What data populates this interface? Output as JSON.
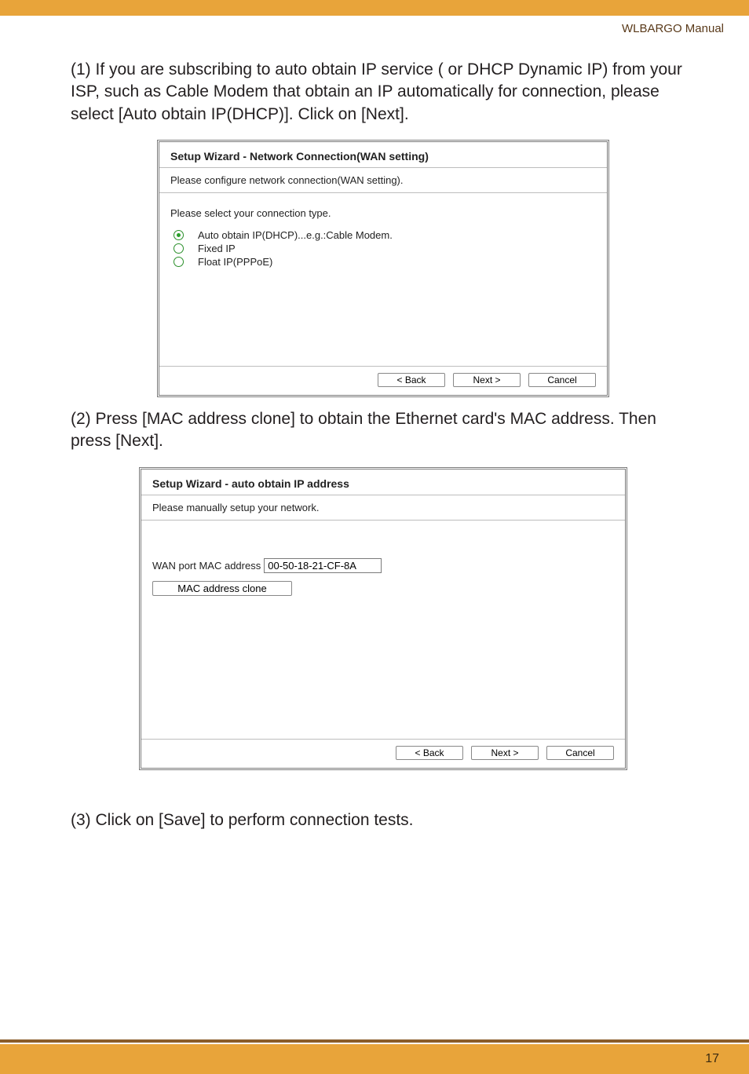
{
  "header": {
    "manual_name": "WLBARGO Manual"
  },
  "paragraphs": {
    "p1": "(1) If you are subscribing to auto obtain IP service ( or DHCP Dynamic IP) from your ISP, such as Cable Modem that obtain an IP automatically for connection, please select [Auto obtain IP(DHCP)]. Click on [Next].",
    "p2": "(2) Press [MAC address clone] to obtain the Ethernet card's MAC address. Then press [Next].",
    "p3": "(3) Click on [Save] to perform connection tests."
  },
  "wizard1": {
    "title": "Setup Wizard - Network Connection(WAN setting)",
    "subtitle": "Please configure network connection(WAN setting).",
    "prompt": "Please select your connection type.",
    "options": [
      {
        "label": "Auto obtain IP(DHCP)...e.g.:Cable Modem.",
        "selected": true
      },
      {
        "label": "Fixed IP",
        "selected": false
      },
      {
        "label": "Float IP(PPPoE)",
        "selected": false
      }
    ],
    "buttons": {
      "back": "< Back",
      "next": "Next >",
      "cancel": "Cancel"
    }
  },
  "wizard2": {
    "title": "Setup Wizard - auto obtain IP address",
    "subtitle": "Please manually setup your network.",
    "mac_label": "WAN port MAC address",
    "mac_value": "00-50-18-21-CF-8A",
    "clone_button": "MAC address clone",
    "buttons": {
      "back": "< Back",
      "next": "Next >",
      "cancel": "Cancel"
    }
  },
  "footer": {
    "page_number": "17"
  }
}
